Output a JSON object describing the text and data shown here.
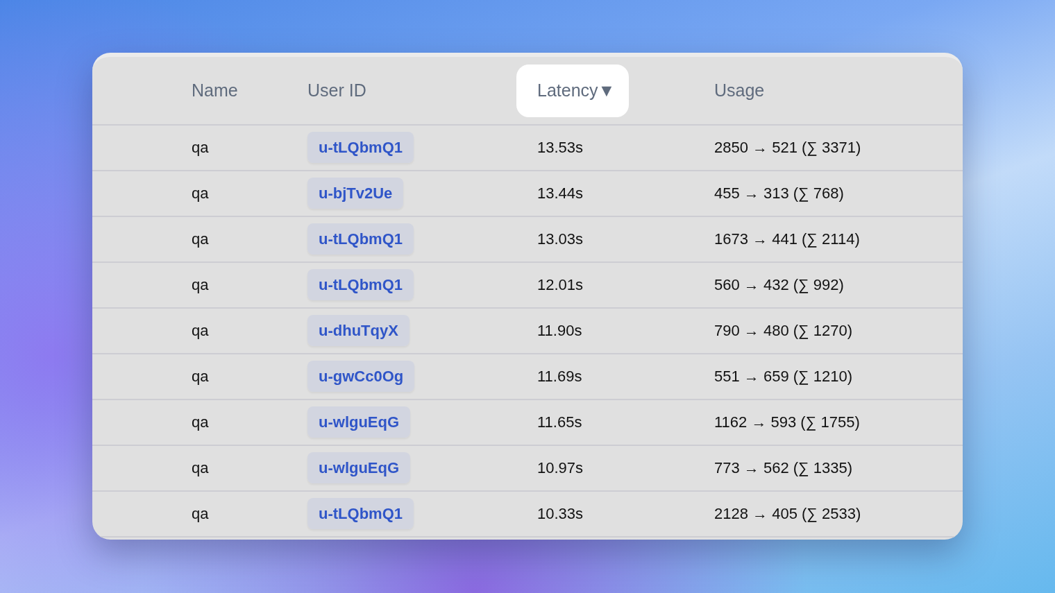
{
  "table": {
    "columns": [
      {
        "label": "Name",
        "selected": false
      },
      {
        "label": "User ID",
        "selected": false
      },
      {
        "label": "Latency",
        "selected": true,
        "sort_indicator": "▼"
      },
      {
        "label": "Usage",
        "selected": false
      }
    ],
    "rows": [
      {
        "name": "qa",
        "user_id": "u-tLQbmQ1",
        "latency": "13.53s",
        "usage": "2850 → 521 (∑ 3371)"
      },
      {
        "name": "qa",
        "user_id": "u-bjTv2Ue",
        "latency": "13.44s",
        "usage": "455 → 313 (∑ 768)"
      },
      {
        "name": "qa",
        "user_id": "u-tLQbmQ1",
        "latency": "13.03s",
        "usage": "1673 → 441 (∑ 2114)"
      },
      {
        "name": "qa",
        "user_id": "u-tLQbmQ1",
        "latency": "12.01s",
        "usage": "560 → 432 (∑ 992)"
      },
      {
        "name": "qa",
        "user_id": "u-dhuTqyX",
        "latency": "11.90s",
        "usage": "790 → 480 (∑ 1270)"
      },
      {
        "name": "qa",
        "user_id": "u-gwCc0Og",
        "latency": "11.69s",
        "usage": "551 → 659 (∑ 1210)"
      },
      {
        "name": "qa",
        "user_id": "u-wlguEqG",
        "latency": "11.65s",
        "usage": "1162 → 593 (∑ 1755)"
      },
      {
        "name": "qa",
        "user_id": "u-wlguEqG",
        "latency": "10.97s",
        "usage": "773 → 562 (∑ 1335)"
      },
      {
        "name": "qa",
        "user_id": "u-tLQbmQ1",
        "latency": "10.33s",
        "usage": "2128 → 405 (∑ 2533)"
      }
    ]
  }
}
